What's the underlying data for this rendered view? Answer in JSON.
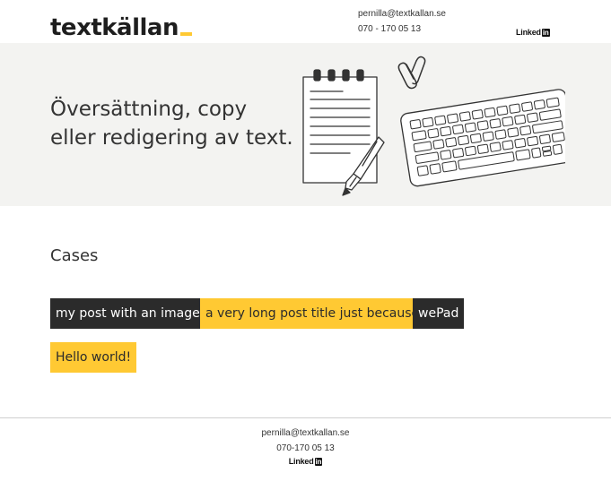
{
  "header": {
    "logo_text": "textkällan",
    "email": "pernilla@textkallan.se",
    "phone": "070 - 170 05 13",
    "linkedin_word": "Linked",
    "linkedin_badge": "in"
  },
  "hero": {
    "line1": "Översättning, copy",
    "line2": "eller redigering av text.",
    "illustration_icons": [
      "notepad-icon",
      "fountain-pen-icon",
      "paperclip-icon",
      "keyboard-icon"
    ]
  },
  "cases": {
    "title": "Cases",
    "items": [
      {
        "label": "my post with an image",
        "style": "dark"
      },
      {
        "label": "a very long post title just because",
        "style": "yellow"
      },
      {
        "label": "wePad",
        "style": "dark"
      },
      {
        "label": "Hello world!",
        "style": "yellow"
      }
    ]
  },
  "footer": {
    "email": "pernilla@textkallan.se",
    "phone": "070-170 05 13",
    "linkedin_word": "Linked",
    "linkedin_badge": "in"
  },
  "colors": {
    "accent": "#ffc933",
    "dark": "#2b2b2b",
    "hero_bg": "#f3f3f1"
  }
}
